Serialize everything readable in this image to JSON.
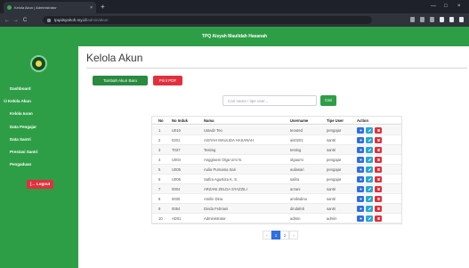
{
  "browser": {
    "tab_title": "Kelola Akun | Administrator",
    "tab_close": "×",
    "new_tab": "+",
    "win_min": "—",
    "win_max": "□",
    "win_close": "×",
    "back": "←",
    "forward": "→",
    "reload": "C",
    "url_host": "tpqalsyahoh.my.id",
    "url_path": "/admin/akun"
  },
  "header": {
    "title": "TPQ Aisyah Maulidah Hasanah"
  },
  "sidebar": {
    "items": [
      {
        "label": "Dashboard",
        "chev": ""
      },
      {
        "label": "Kelola Akun",
        "chev": "⚇"
      },
      {
        "label": "Kelola Iuran",
        "chev": ""
      },
      {
        "label": "Data Pengajar",
        "chev": ""
      },
      {
        "label": "Data Santri",
        "chev": ""
      },
      {
        "label": "Prestasi Santri",
        "chev": ""
      },
      {
        "label": "Pengaduan",
        "chev": ""
      }
    ],
    "logout_label": "[→ Logout"
  },
  "main": {
    "page_title": "Kelola Akun",
    "add_button": "Tambah Akun Baru",
    "pdf_button": "Print PDF",
    "search_placeholder": "Cari nama / tipe user...",
    "search_button": "Cari"
  },
  "table": {
    "headers": [
      "No",
      "No Induk",
      "Nama",
      "Username",
      "Tipe User",
      "Action"
    ],
    "rows": [
      {
        "no": "1",
        "nis": "U010",
        "nama": "Ustadz Teo",
        "user": "teouted",
        "tipe": "pengajar"
      },
      {
        "no": "2",
        "nis": "0201",
        "nama": "AISYAH MAULIDA HASANAH",
        "user": "ais0201",
        "tipe": "santri"
      },
      {
        "no": "3",
        "nis": "T037",
        "nama": "Testing",
        "user": "testing",
        "tipe": "santri"
      },
      {
        "no": "4",
        "nis": "U004",
        "nama": "Anggraeni Olga Umi N.",
        "user": "olgaumi",
        "tipe": "pengajar"
      },
      {
        "no": "5",
        "nis": "U005",
        "nama": "Aulia Purnama Sari",
        "user": "auliasari",
        "tipe": "pengajar"
      },
      {
        "no": "6",
        "nis": "U006",
        "nama": "Safira Agustiza K. S.",
        "user": "safira",
        "tipe": "pengajar"
      },
      {
        "no": "7",
        "nis": "0004",
        "nama": "ARZANI ZELDA SYAZZILI",
        "user": "arzani",
        "tipe": "santri"
      },
      {
        "no": "8",
        "nis": "0030",
        "nama": "Amilin Dina",
        "user": "amilindina",
        "tipe": "santri"
      },
      {
        "no": "9",
        "nis": "0054",
        "nama": "Dinda Febriani",
        "user": "dindafeb",
        "tipe": "santri"
      },
      {
        "no": "10",
        "nis": "AD01",
        "nama": "Administrator",
        "user": "admin",
        "tipe": "admin"
      }
    ]
  },
  "pagination": {
    "prev": "‹",
    "pages": [
      "1",
      "2"
    ],
    "next": "›",
    "current": "1"
  },
  "colors": {
    "primary_green": "#2e9e46",
    "danger_red": "#e0303d",
    "info_blue": "#2f6fe0",
    "cyan": "#29a8d4"
  }
}
